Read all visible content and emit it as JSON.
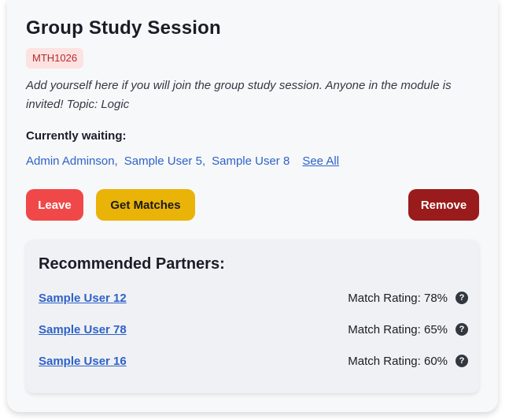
{
  "session": {
    "title": "Group Study Session",
    "module_code": "MTH1026",
    "description": "Add yourself here if you will join the group study session. Anyone in the module is invited!  Topic: Logic",
    "waiting_label": "Currently waiting:",
    "waiting_users": [
      "Admin Adminson,",
      "Sample User 5,",
      "Sample User 8"
    ],
    "see_all_label": "See All"
  },
  "actions": {
    "leave_label": "Leave",
    "get_matches_label": "Get Matches",
    "remove_label": "Remove"
  },
  "partners": {
    "title": "Recommended Partners:",
    "items": [
      {
        "name": "Sample User 12",
        "rating": "Match Rating: 78%"
      },
      {
        "name": "Sample User 78",
        "rating": "Match Rating: 65%"
      },
      {
        "name": "Sample User 16",
        "rating": "Match Rating: 60%"
      }
    ],
    "help_icon": "question-circle-icon",
    "help_glyph": "?"
  },
  "colors": {
    "badge_bg": "#fde2e2",
    "badge_text": "#b32b2b",
    "link": "#2e62c8",
    "leave_button": "#f04848",
    "get_matches_button": "#eab307",
    "remove_button": "#9a1b1b"
  }
}
